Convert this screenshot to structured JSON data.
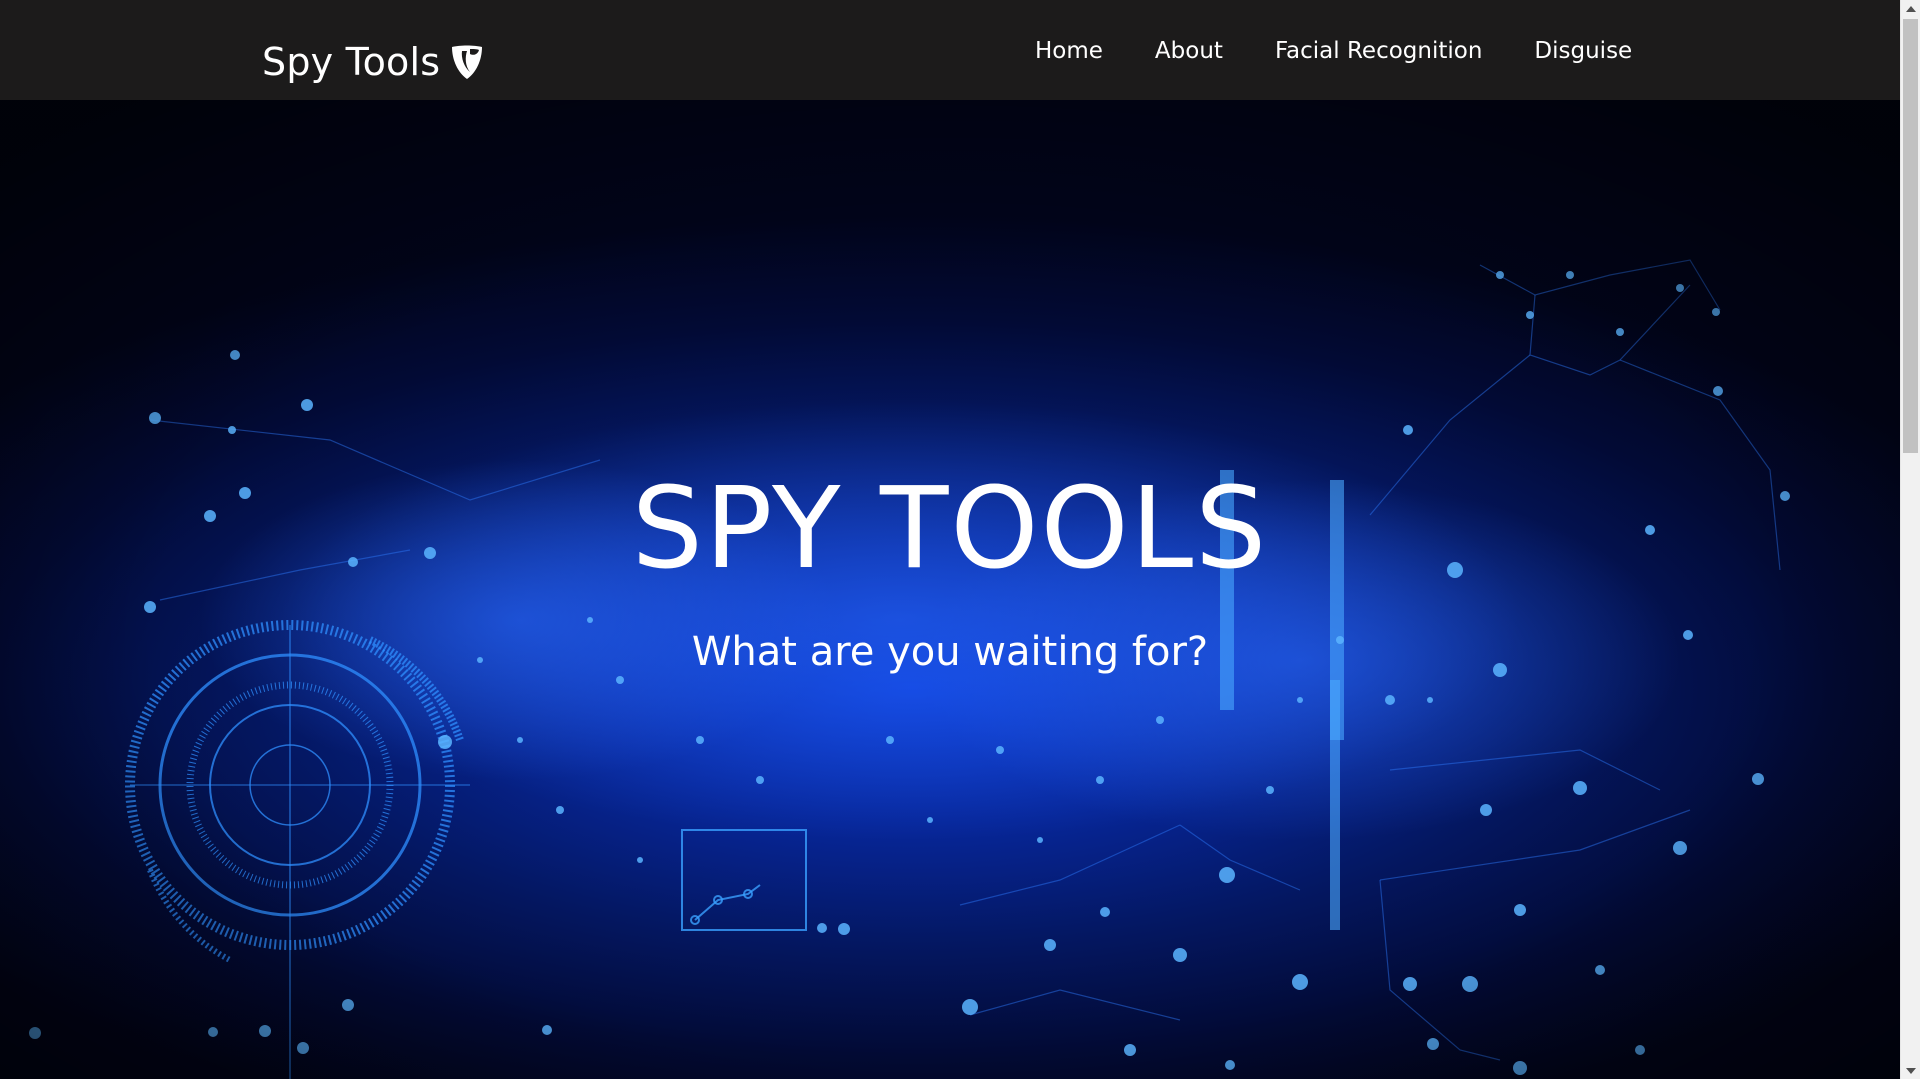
{
  "navbar": {
    "brand": "Spy Tools",
    "brand_icon": "typo3-shield-icon",
    "links": [
      "Home",
      "About",
      "Facial Recognition",
      "Disguise"
    ]
  },
  "hero": {
    "title": "SPY TOOLS",
    "subtitle": "What are you waiting for?"
  },
  "colors": {
    "navbar_bg": "#1c1b1b",
    "hero_accent": "#0b3bd6",
    "text": "#ffffff"
  }
}
